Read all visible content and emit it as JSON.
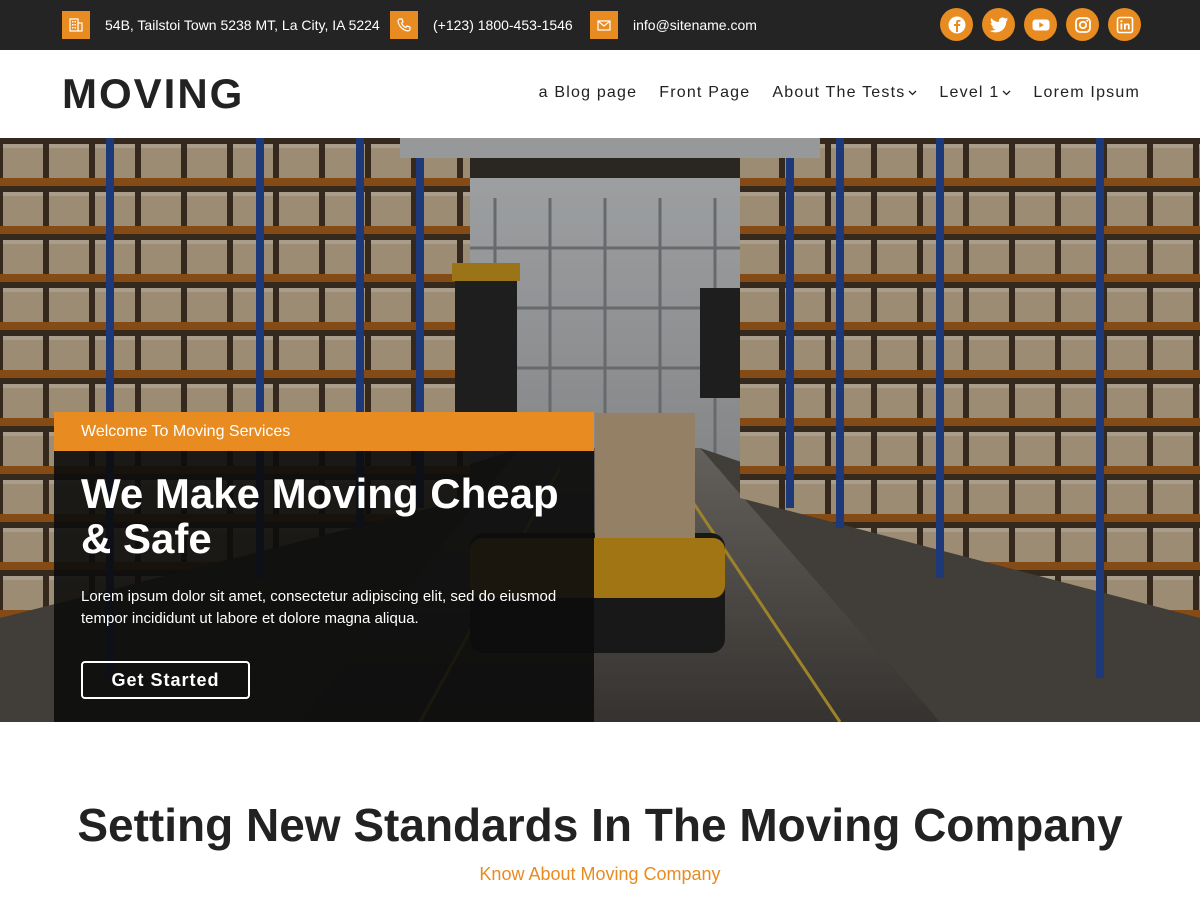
{
  "topbar": {
    "address": "54B, Tailstoi Town 5238 MT, La City, IA 5224",
    "phone": "(+123) 1800-453-1546",
    "email": "info@sitename.com",
    "icons": [
      "building-icon",
      "phone-icon",
      "email-icon"
    ],
    "social": [
      "facebook-icon",
      "twitter-icon",
      "youtube-icon",
      "instagram-icon",
      "linkedin-icon"
    ]
  },
  "header": {
    "logo": "MOVING",
    "nav": [
      {
        "label": "a Blog page",
        "dropdown": false
      },
      {
        "label": "Front Page",
        "dropdown": false
      },
      {
        "label": "About The Tests",
        "dropdown": true
      },
      {
        "label": "Level 1",
        "dropdown": true
      },
      {
        "label": "Lorem Ipsum",
        "dropdown": false
      }
    ]
  },
  "hero": {
    "tag": "Welcome To Moving Services",
    "title": "We Make Moving Cheap & Safe",
    "description": "Lorem ipsum dolor sit amet, consectetur adipiscing elit, sed do eiusmod tempor incididunt ut labore et dolore magna aliqua.",
    "button": "Get Started"
  },
  "section": {
    "title": "Setting New Standards In The Moving Company",
    "subtitle": "Know About Moving Company"
  },
  "colors": {
    "accent": "#e88b20",
    "topbar_bg": "#242424",
    "text_dark": "#222222"
  }
}
